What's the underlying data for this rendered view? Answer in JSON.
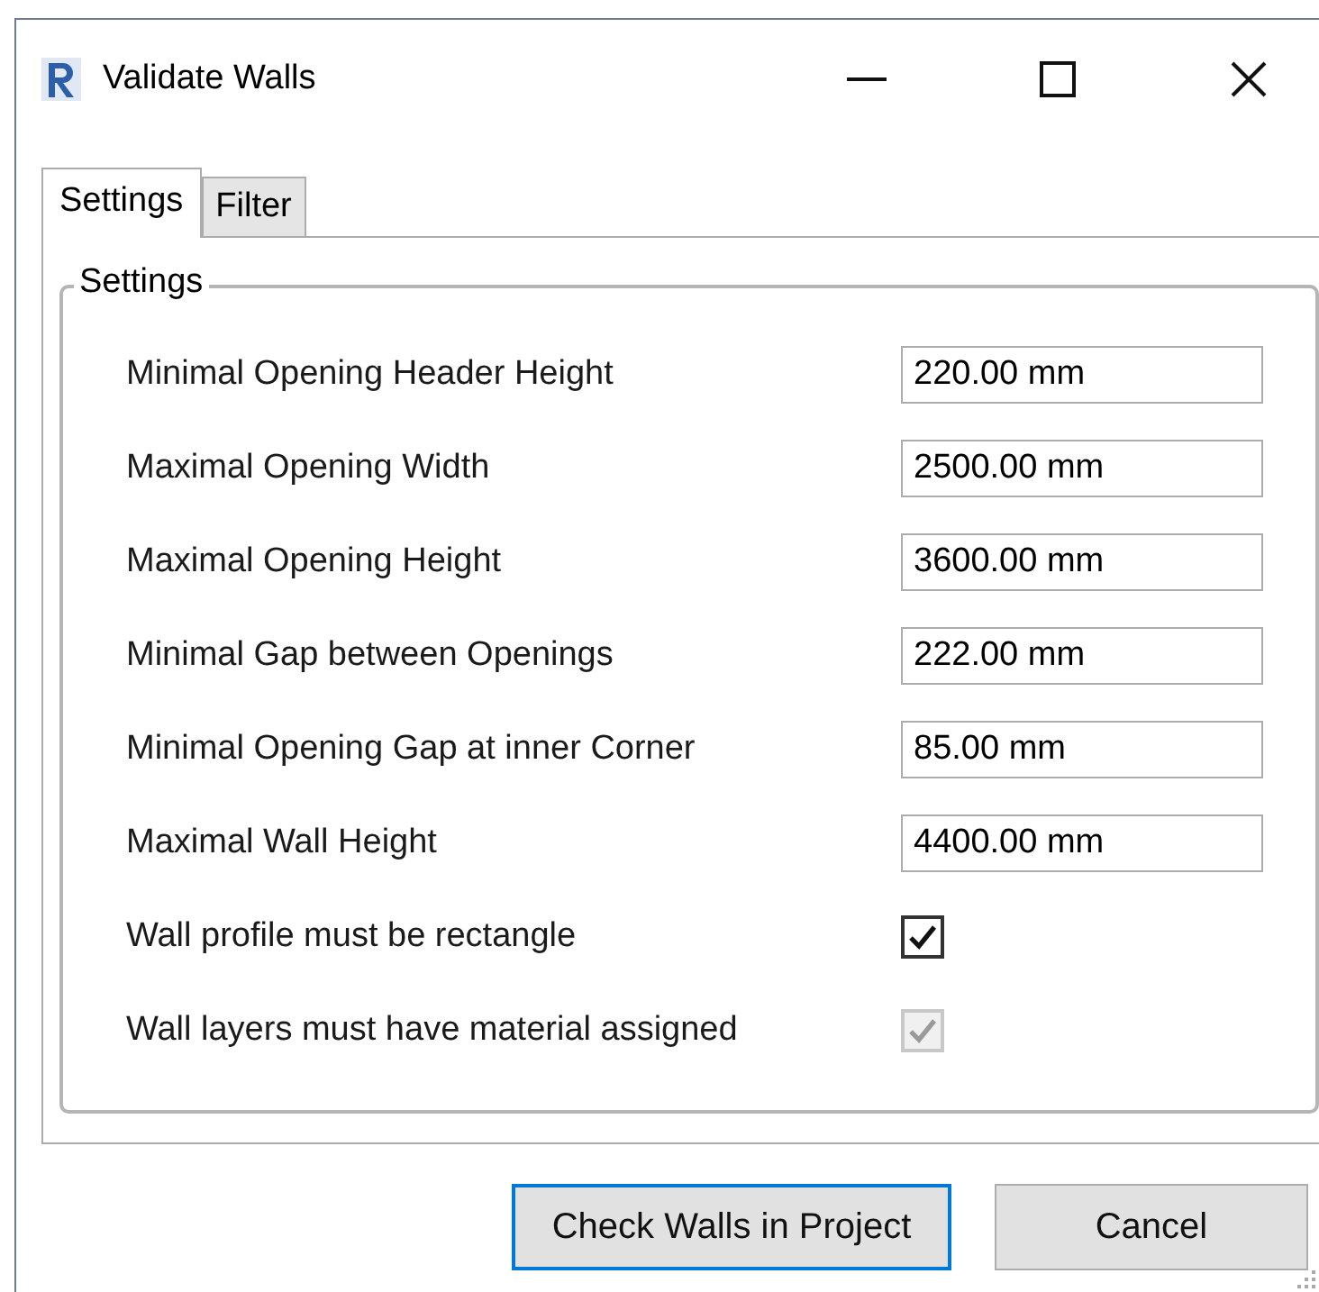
{
  "window": {
    "title": "Validate Walls"
  },
  "tabs": [
    {
      "label": "Settings",
      "selected": true
    },
    {
      "label": "Filter",
      "selected": false
    }
  ],
  "group": {
    "title": "Settings",
    "rows": [
      {
        "kind": "text",
        "label": "Minimal Opening Header Height",
        "value": "220.00 mm"
      },
      {
        "kind": "text",
        "label": "Maximal Opening Width",
        "value": "2500.00 mm"
      },
      {
        "kind": "text",
        "label": "Maximal Opening Height",
        "value": "3600.00 mm"
      },
      {
        "kind": "text",
        "label": "Minimal Gap between Openings",
        "value": "222.00 mm"
      },
      {
        "kind": "text",
        "label": "Minimal Opening Gap at inner Corner",
        "value": "85.00 mm"
      },
      {
        "kind": "text",
        "label": "Maximal Wall Height",
        "value": "4400.00 mm"
      },
      {
        "kind": "checkbox",
        "label": "Wall profile must be rectangle",
        "checked": true,
        "disabled": false
      },
      {
        "kind": "checkbox",
        "label": "Wall layers must have material assigned",
        "checked": true,
        "disabled": true
      }
    ]
  },
  "buttons": [
    {
      "label": "Check Walls in Project",
      "default": true
    },
    {
      "label": "Cancel",
      "default": false
    }
  ]
}
